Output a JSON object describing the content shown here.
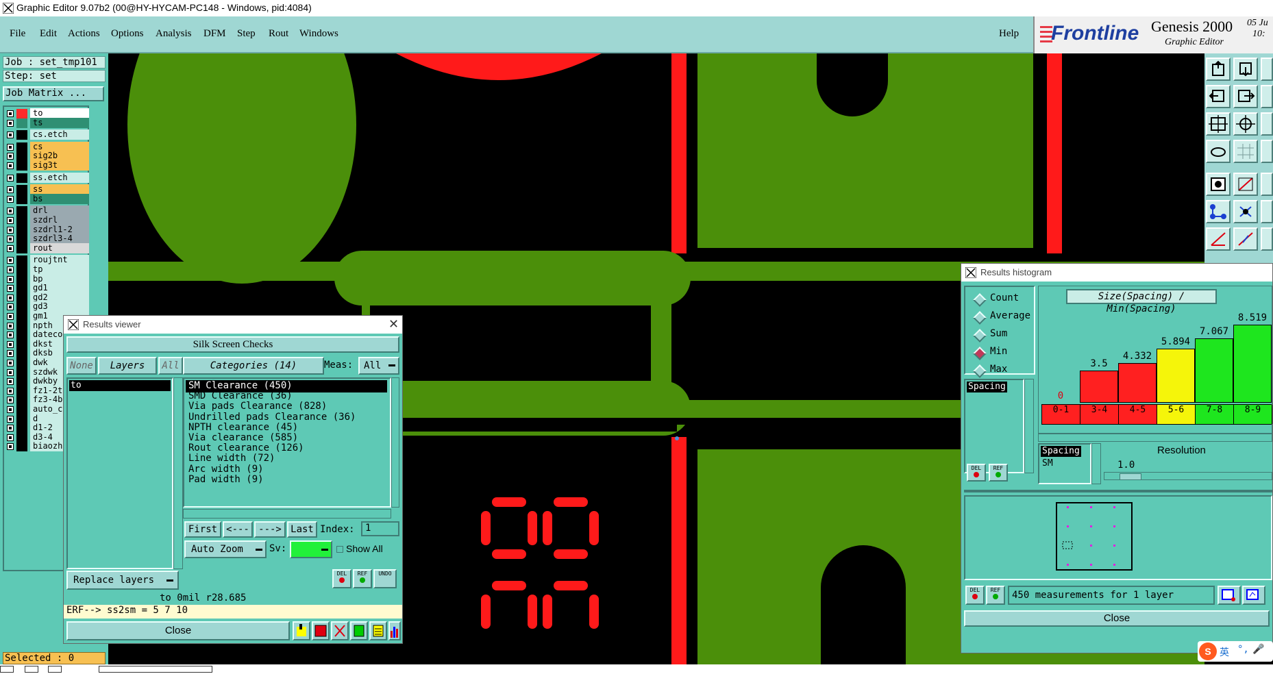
{
  "window": {
    "title": "Graphic Editor 9.07b2 (00@HY-HYCAM-PC148 - Windows, pid:4084)"
  },
  "menu": {
    "items": [
      "File",
      "Edit",
      "Actions",
      "Options",
      "Analysis",
      "DFM",
      "Step",
      "Rout",
      "Windows"
    ],
    "help": "Help"
  },
  "brand": {
    "logo": "Frontline",
    "product": "Genesis 2000",
    "subtitle": "Graphic Editor",
    "date": "05 Ju",
    "time": "10:"
  },
  "left_panel": {
    "job": "Job : set_tmp101",
    "step": "Step: set",
    "job_matrix": "Job Matrix ...",
    "layers": [
      {
        "name": "to",
        "color": "#ffffff",
        "swatch": "#ff2a2a"
      },
      {
        "name": "ts",
        "color": "#2f8f73",
        "swatch": "#2f8f73"
      },
      {
        "name": "cs.etch",
        "color": "#c9ede6",
        "swatch": ""
      },
      {
        "name": "cs",
        "color": "#f7c052",
        "swatch": ""
      },
      {
        "name": "sig2b",
        "color": "#f7c052",
        "swatch": ""
      },
      {
        "name": "sig3t",
        "color": "#f7c052",
        "swatch": ""
      },
      {
        "name": "ss.etch",
        "color": "#c9ede6",
        "swatch": ""
      },
      {
        "name": "ss",
        "color": "#f7c052",
        "swatch": ""
      },
      {
        "name": "bs",
        "color": "#2f8f73",
        "swatch": ""
      },
      {
        "name": "drl",
        "color": "#9aa9b0",
        "swatch": ""
      },
      {
        "name": "szdrl",
        "color": "#9aa9b0",
        "swatch": ""
      },
      {
        "name": "szdrl1-2",
        "color": "#9aa9b0",
        "swatch": ""
      },
      {
        "name": "szdrl3-4",
        "color": "#9aa9b0",
        "swatch": ""
      },
      {
        "name": "rout",
        "color": "#d9d9d9",
        "swatch": ""
      },
      {
        "name": "roujtnt",
        "color": "#c9ede6",
        "swatch": ""
      },
      {
        "name": "tp",
        "color": "#c9ede6",
        "swatch": ""
      },
      {
        "name": "bp",
        "color": "#c9ede6",
        "swatch": ""
      },
      {
        "name": "gd1",
        "color": "#c9ede6",
        "swatch": ""
      },
      {
        "name": "gd2",
        "color": "#c9ede6",
        "swatch": ""
      },
      {
        "name": "gd3",
        "color": "#c9ede6",
        "swatch": ""
      },
      {
        "name": "gm1",
        "color": "#c9ede6",
        "swatch": ""
      },
      {
        "name": "npth",
        "color": "#c9ede6",
        "swatch": ""
      },
      {
        "name": "datecode",
        "color": "#c9ede6",
        "swatch": ""
      },
      {
        "name": "dkst",
        "color": "#c9ede6",
        "swatch": ""
      },
      {
        "name": "dksb",
        "color": "#c9ede6",
        "swatch": ""
      },
      {
        "name": "dwk",
        "color": "#c9ede6",
        "swatch": ""
      },
      {
        "name": "szdwk",
        "color": "#c9ede6",
        "swatch": ""
      },
      {
        "name": "dwkby",
        "color": "#c9ede6",
        "swatch": ""
      },
      {
        "name": "fz1-2t",
        "color": "#c9ede6",
        "swatch": ""
      },
      {
        "name": "fz3-4b",
        "color": "#c9ede6",
        "swatch": ""
      },
      {
        "name": "auto_ch",
        "color": "#c9ede6",
        "swatch": ""
      },
      {
        "name": "d",
        "color": "#c9ede6",
        "swatch": ""
      },
      {
        "name": "d1-2",
        "color": "#c9ede6",
        "swatch": ""
      },
      {
        "name": "d3-4",
        "color": "#c9ede6",
        "swatch": ""
      },
      {
        "name": "biaozhu",
        "color": "#c9ede6",
        "swatch": ""
      }
    ],
    "selected": "Selected : 0"
  },
  "results_viewer": {
    "title": "Results viewer",
    "header": "Silk Screen Checks",
    "none_btn": "None",
    "layers_btn": "Layers",
    "all_btn": "All",
    "categories_btn": "Categories (14)",
    "meas_label": "Meas:",
    "meas_value": "All",
    "layer_list": [
      "to"
    ],
    "categories": [
      "SM Clearance (450)",
      "SMD Clearance (36)",
      "Via pads Clearance (828)",
      "Undrilled pads Clearance (36)",
      "NPTH clearance (45)",
      "Via clearance (585)",
      "Rout clearance (126)",
      "Line width (72)",
      "Arc width (9)",
      "Pad width (9)"
    ],
    "first": "First",
    "prev": "<---",
    "next": "--->",
    "last": "Last",
    "index_label": "Index:",
    "index_value": "1",
    "auto_zoom": "Auto Zoom",
    "sv_label": "Sv:",
    "show_all": "Show All",
    "replace_layers": "Replace layers",
    "del": "DEL",
    "ref": "REF",
    "undo": "UNDO",
    "info_line": "to 0mil  r28.685",
    "erf_line": "ERF--> ss2sm = 5 7 10",
    "close": "Close"
  },
  "histogram": {
    "title": "Results histogram",
    "modes": [
      "Count",
      "Average",
      "Sum",
      "Min",
      "Max"
    ],
    "selected_mode": "Min",
    "chart_title": "Size(Spacing) / Min(Spacing)",
    "list_left": [
      "Spacing"
    ],
    "resolution_label": "Resolution",
    "resolution_value": "1.0",
    "list_bottom": [
      "Spacing",
      "SM"
    ],
    "del": "DEL",
    "ref": "REF",
    "status": "450 measurements for 1 layer",
    "close": "Close"
  },
  "chart_data": {
    "type": "bar",
    "title": "Size(Spacing) / Min(Spacing)",
    "categories": [
      "0-1",
      "3-4",
      "4-5",
      "5-6",
      "7-8",
      "8-9"
    ],
    "values": [
      0,
      3.5,
      4.332,
      5.894,
      7.067,
      8.519
    ],
    "labels": [
      "0",
      "3.5",
      "4.332",
      "5.894",
      "7.067",
      "8.519"
    ],
    "colors": [
      "#ff2020",
      "#ff2020",
      "#ff2020",
      "#f5f50a",
      "#1ee61e",
      "#1ee61e"
    ],
    "ylim": [
      0,
      9
    ]
  },
  "ime": {
    "label": "英"
  }
}
